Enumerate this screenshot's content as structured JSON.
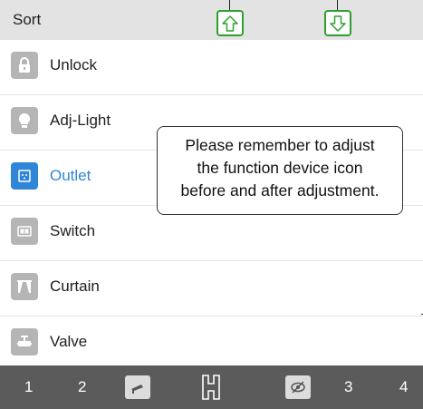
{
  "header": {
    "title": "Sort",
    "move_up_icon": "arrow-up-icon",
    "move_down_icon": "arrow-down-icon",
    "accent": "#2da12f"
  },
  "list": {
    "selected_color": "#2f86d8",
    "items": [
      {
        "label": "Unlock",
        "icon": "lock-icon"
      },
      {
        "label": "Adj-Light",
        "icon": "lightbulb-icon"
      },
      {
        "label": "Outlet",
        "icon": "outlet-icon",
        "selected": true
      },
      {
        "label": "Switch",
        "icon": "switch-icon"
      },
      {
        "label": "Curtain",
        "icon": "curtain-icon"
      },
      {
        "label": "Valve",
        "icon": "valve-icon"
      }
    ]
  },
  "callout": {
    "line1": "Please remember to adjust",
    "line2": "the function device icon",
    "line3": "before and after adjustment."
  },
  "footer": {
    "tabs": [
      "1",
      "2",
      "3",
      "4"
    ],
    "icons": [
      "camera-icon",
      "building-icon",
      "hidden-eye-icon"
    ]
  }
}
